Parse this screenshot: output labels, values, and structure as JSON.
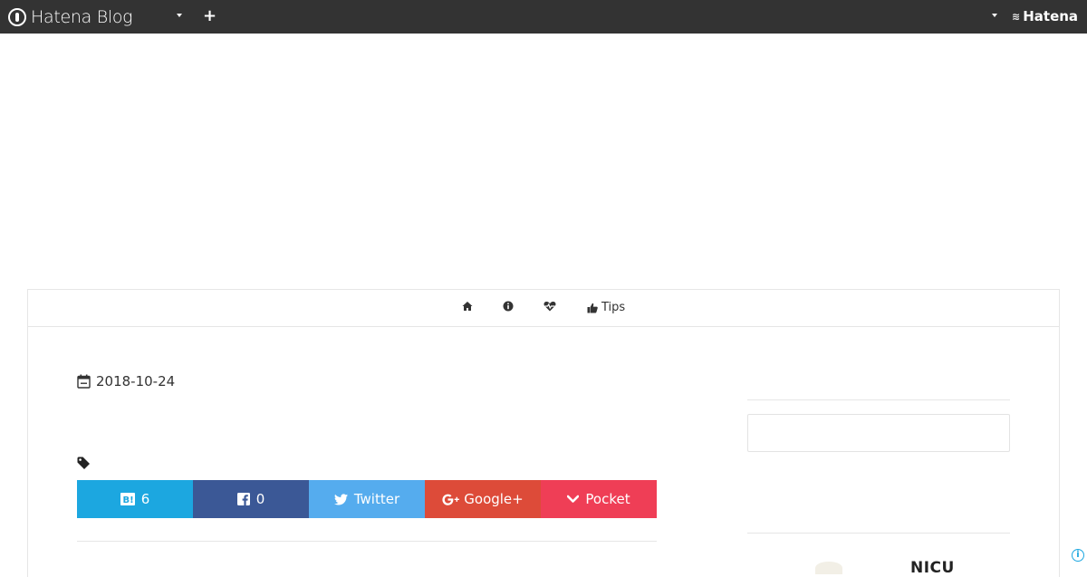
{
  "topbar": {
    "brand": "Hatena Blog",
    "right_brand": "Hatena"
  },
  "nav": {
    "items": [
      {
        "icon": "home-icon",
        "label": ""
      },
      {
        "icon": "info-icon",
        "label": ""
      },
      {
        "icon": "heartbeat-icon",
        "label": ""
      },
      {
        "icon": "thumbs-up-icon",
        "label": "Tips"
      }
    ]
  },
  "article": {
    "date": "2018-10-24"
  },
  "share": {
    "hatena_count": "6",
    "facebook_count": "0",
    "twitter_label": "Twitter",
    "googleplus_label": "Google+",
    "pocket_label": "Pocket"
  },
  "sidebar": {
    "search_placeholder": "",
    "profile_title": "NICU"
  },
  "colors": {
    "topbar": "#333333",
    "hatena_bookmark": "#1ca7e0",
    "facebook": "#3b5896",
    "twitter": "#55acee",
    "googleplus": "#dd4b39",
    "pocket": "#ef3e56"
  }
}
